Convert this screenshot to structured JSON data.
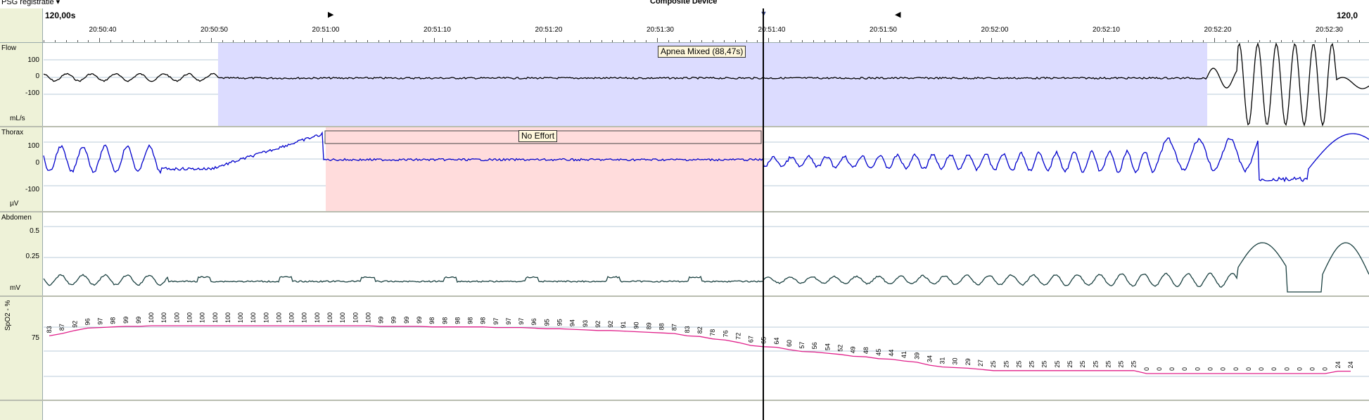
{
  "window": {
    "left_title": "PSG registratie ▾",
    "center_title": "Composite Device"
  },
  "ruler": {
    "span_left": "120,00s",
    "span_right": "120,0",
    "times": [
      "20:50:40",
      "20:50:50",
      "20:51:00",
      "20:51:10",
      "20:51:20",
      "20:51:30",
      "20:51:40",
      "20:51:50",
      "20:52:00",
      "20:52:10",
      "20:52:20",
      "20:52:30"
    ],
    "markers": {
      "start": "▶",
      "cursor": "▼",
      "end": "◀"
    }
  },
  "channels": {
    "flow": {
      "label": "Flow",
      "unit": "mL/s",
      "ticks": [
        "100",
        "0",
        "-100"
      ]
    },
    "thorax": {
      "label": "Thorax",
      "unit": "µV",
      "ticks": [
        "100",
        "0",
        "-100"
      ]
    },
    "abdomen": {
      "label": "Abdomen",
      "unit": "mV",
      "ticks": [
        "0.5",
        "0.25"
      ]
    },
    "spo2": {
      "label": "SpO2 - %",
      "ticks": [
        "75"
      ]
    }
  },
  "events": {
    "apnea_label": "Apnea Mixed (88,47s)",
    "no_effort_label": "No Effort"
  },
  "colors": {
    "apnea_band": "#dcdcff",
    "no_effort_band": "#ffdcdc",
    "flow_trace": "#000000",
    "thorax_trace": "#0000cc",
    "abdomen_trace": "#1a4040",
    "spo2_trace": "#e0208a",
    "gutter": "#eef2d8"
  },
  "spo2_values": [
    "83",
    "87",
    "92",
    "96",
    "97",
    "98",
    "99",
    "99",
    "100",
    "100",
    "100",
    "100",
    "100",
    "100",
    "100",
    "100",
    "100",
    "100",
    "100",
    "100",
    "100",
    "100",
    "100",
    "100",
    "100",
    "100",
    "99",
    "99",
    "99",
    "99",
    "98",
    "98",
    "98",
    "98",
    "98",
    "97",
    "97",
    "97",
    "96",
    "95",
    "95",
    "94",
    "93",
    "92",
    "92",
    "91",
    "90",
    "89",
    "88",
    "87",
    "83",
    "82",
    "78",
    "76",
    "72",
    "67",
    "65",
    "64",
    "60",
    "57",
    "56",
    "54",
    "52",
    "49",
    "48",
    "45",
    "44",
    "41",
    "39",
    "34",
    "31",
    "30",
    "29",
    "27",
    "25",
    "25",
    "25",
    "25",
    "25",
    "25",
    "25",
    "25",
    "25",
    "25",
    "25",
    "25",
    "0",
    "0",
    "0",
    "0",
    "0",
    "0",
    "0",
    "0",
    "0",
    "0",
    "0",
    "0",
    "0",
    "0",
    "0",
    "24",
    "24"
  ]
}
